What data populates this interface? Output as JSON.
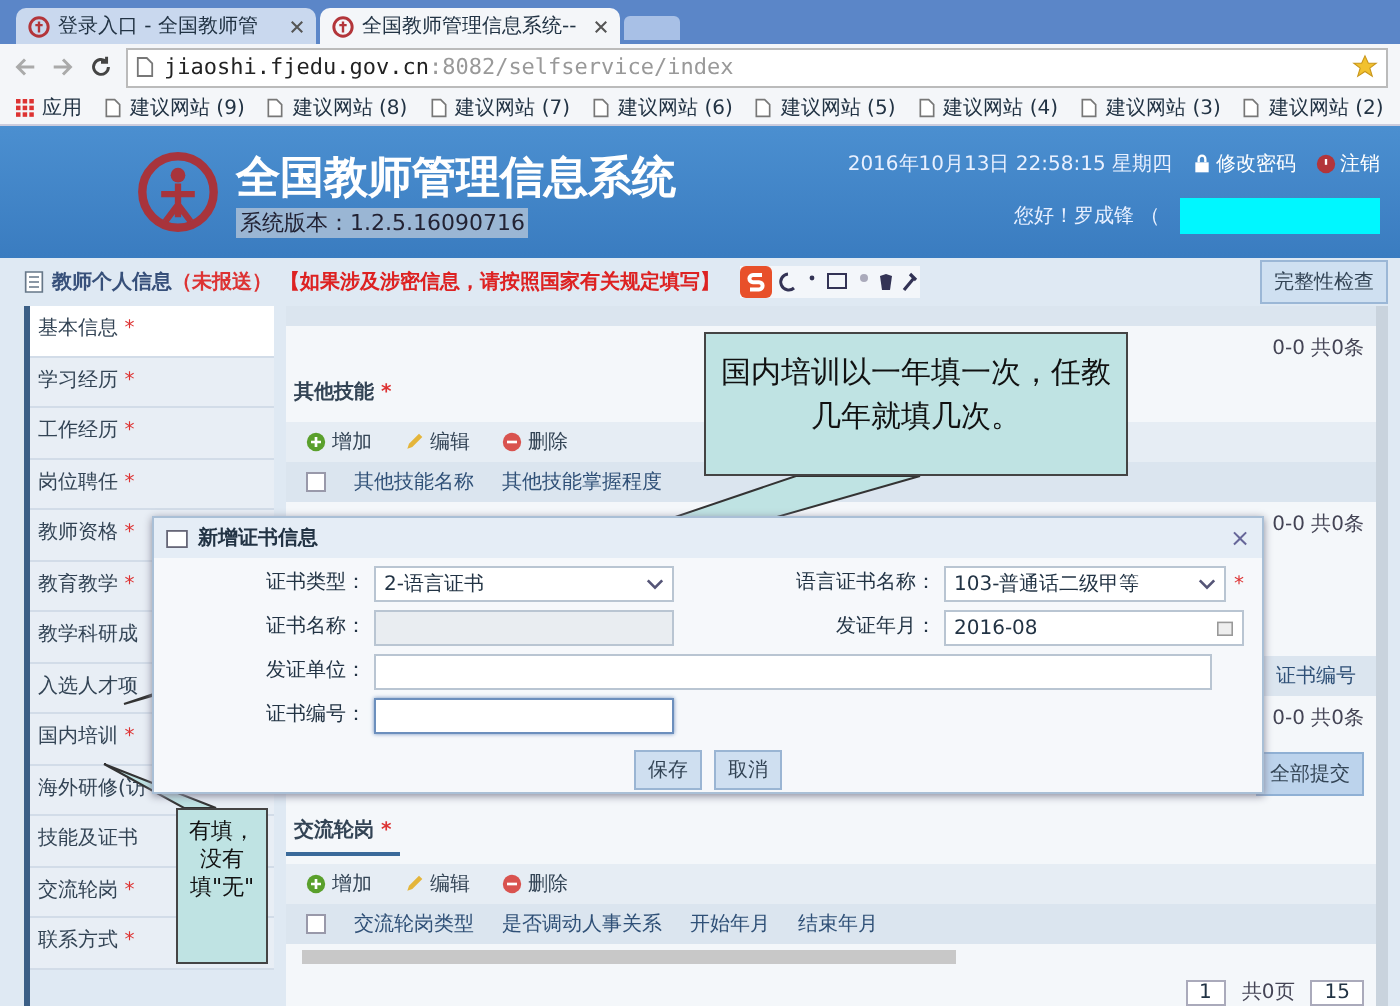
{
  "browser": {
    "tabs": [
      {
        "label": "登录入口 - 全国教师管",
        "selected": false
      },
      {
        "label": "全国教师管理信息系统--",
        "selected": true
      }
    ],
    "url_host": "jiaoshi.fjedu.gov.cn",
    "url_rest": ":8082/selfservice/index",
    "bookmarks": [
      "应用",
      "建议网站 (9)",
      "建议网站 (8)",
      "建议网站 (7)",
      "建议网站 (6)",
      "建议网站 (5)",
      "建议网站 (4)",
      "建议网站 (3)",
      "建议网站 (2)"
    ]
  },
  "header": {
    "title": "全国教师管理信息系统",
    "version": "系统版本：1.2.5.16090716",
    "datetime": "2016年10月13日  22:58:15  星期四",
    "change_password": "修改密码",
    "logout": "注销",
    "greeting": "您好！罗成锋 （"
  },
  "page": {
    "heading": "教师个人信息",
    "status": "（未报送）",
    "notice": "【如果涉及涉密信息，请按照国家有关规定填写】",
    "check_button": "完整性检查"
  },
  "sidebar": {
    "items": [
      {
        "label": "基本信息",
        "mark": "*",
        "selected": true
      },
      {
        "label": "学习经历",
        "mark": "*",
        "selected": false
      },
      {
        "label": "工作经历",
        "mark": "*",
        "selected": false
      },
      {
        "label": "岗位聘任",
        "mark": "*",
        "selected": false
      },
      {
        "label": "教师资格",
        "mark": "*",
        "selected": false
      },
      {
        "label": "教育教学",
        "mark": "*",
        "selected": false
      },
      {
        "label": "教学科研成",
        "selected": false
      },
      {
        "label": "入选人才项",
        "selected": false
      },
      {
        "label": "国内培训",
        "mark": "*",
        "selected": false
      },
      {
        "label": "海外研修(访",
        "selected": false
      },
      {
        "label": "技能及证书",
        "selected": false
      },
      {
        "label": "交流轮岗",
        "mark": "*",
        "selected": false
      },
      {
        "label": "联系方式",
        "mark": "*",
        "selected": false
      }
    ]
  },
  "top_pager": "0-0 共0条",
  "skills": {
    "title": "其他技能",
    "mark": "*",
    "header_checked": false,
    "toolbar": [
      {
        "kind": "add",
        "label": "增加"
      },
      {
        "kind": "edit",
        "label": "编辑"
      },
      {
        "kind": "delete",
        "label": "删除"
      }
    ],
    "columns": [
      "其他技能名称",
      "其他技能掌握程度"
    ],
    "pager": "0-0 共0条"
  },
  "certificates": {
    "columns": [
      "证书编号"
    ],
    "pager": "0-0 共0条"
  },
  "submit_button": "全部提交",
  "rotation": {
    "title": "交流轮岗",
    "mark": "*",
    "header_checked": false,
    "toolbar": [
      {
        "kind": "add",
        "label": "增加"
      },
      {
        "kind": "edit",
        "label": "编辑"
      },
      {
        "kind": "delete",
        "label": "删除"
      }
    ],
    "columns": [
      "交流轮岗类型",
      "是否调动人事关系",
      "开始年月",
      "结束年月"
    ],
    "page": "1",
    "page_count": "共0页",
    "page_size": "15"
  },
  "dialog": {
    "title": "新增证书信息",
    "close": "×",
    "fields": [
      {
        "kind": "select",
        "label": "证书类型：",
        "value": "2-语言证书",
        "focused": false,
        "disabled": false,
        "wide": false
      },
      {
        "kind": "select",
        "label": "语言证书名称：",
        "value": "103-普通话二级甲等",
        "required": "*",
        "focused": false,
        "disabled": false,
        "wide": false
      },
      {
        "kind": "text",
        "label": "证书名称：",
        "focused": false,
        "disabled": true,
        "wide": false
      },
      {
        "kind": "date",
        "label": "发证年月：",
        "value": "2016-08",
        "focused": false,
        "disabled": false,
        "wide": false
      },
      {
        "kind": "text",
        "label": "发证单位：",
        "focused": false,
        "disabled": false,
        "wide": true
      },
      {
        "kind": "text",
        "label": "证书编号：",
        "focused": true,
        "disabled": false,
        "wide": false
      }
    ],
    "buttons": [
      "保存",
      "取消"
    ]
  },
  "callouts": [
    {
      "text": "国内培训以一年填一次，任教几年就填几次。"
    },
    {
      "text": "有填，没有填\"无\""
    }
  ]
}
